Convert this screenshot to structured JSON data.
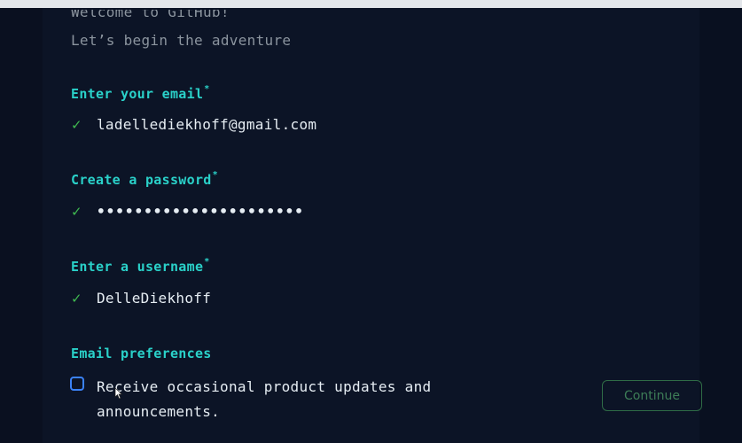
{
  "header": {
    "welcome": "Welcome to GitHub!",
    "subtitle": "Let’s begin the adventure"
  },
  "fields": {
    "email": {
      "label": "Enter your email",
      "required_mark": "*",
      "value": "ladellediekhoff@gmail.com",
      "status_icon": "check-icon"
    },
    "password": {
      "label": "Create a password",
      "required_mark": "*",
      "value": "••••••••••••••••••••••",
      "status_icon": "check-icon"
    },
    "username": {
      "label": "Enter a username",
      "required_mark": "*",
      "value": "DelleDiekhoff",
      "status_icon": "check-icon"
    }
  },
  "preferences": {
    "label": "Email preferences",
    "checkbox_text": "Receive occasional product updates and announcements.",
    "checked": false
  },
  "actions": {
    "continue_label": "Continue"
  },
  "colors": {
    "background": "#0c1426",
    "label_accent": "#2ad1c9",
    "valid_check": "#3fb950",
    "checkbox_border": "#3b82f6",
    "button_border": "#2f6b46"
  }
}
